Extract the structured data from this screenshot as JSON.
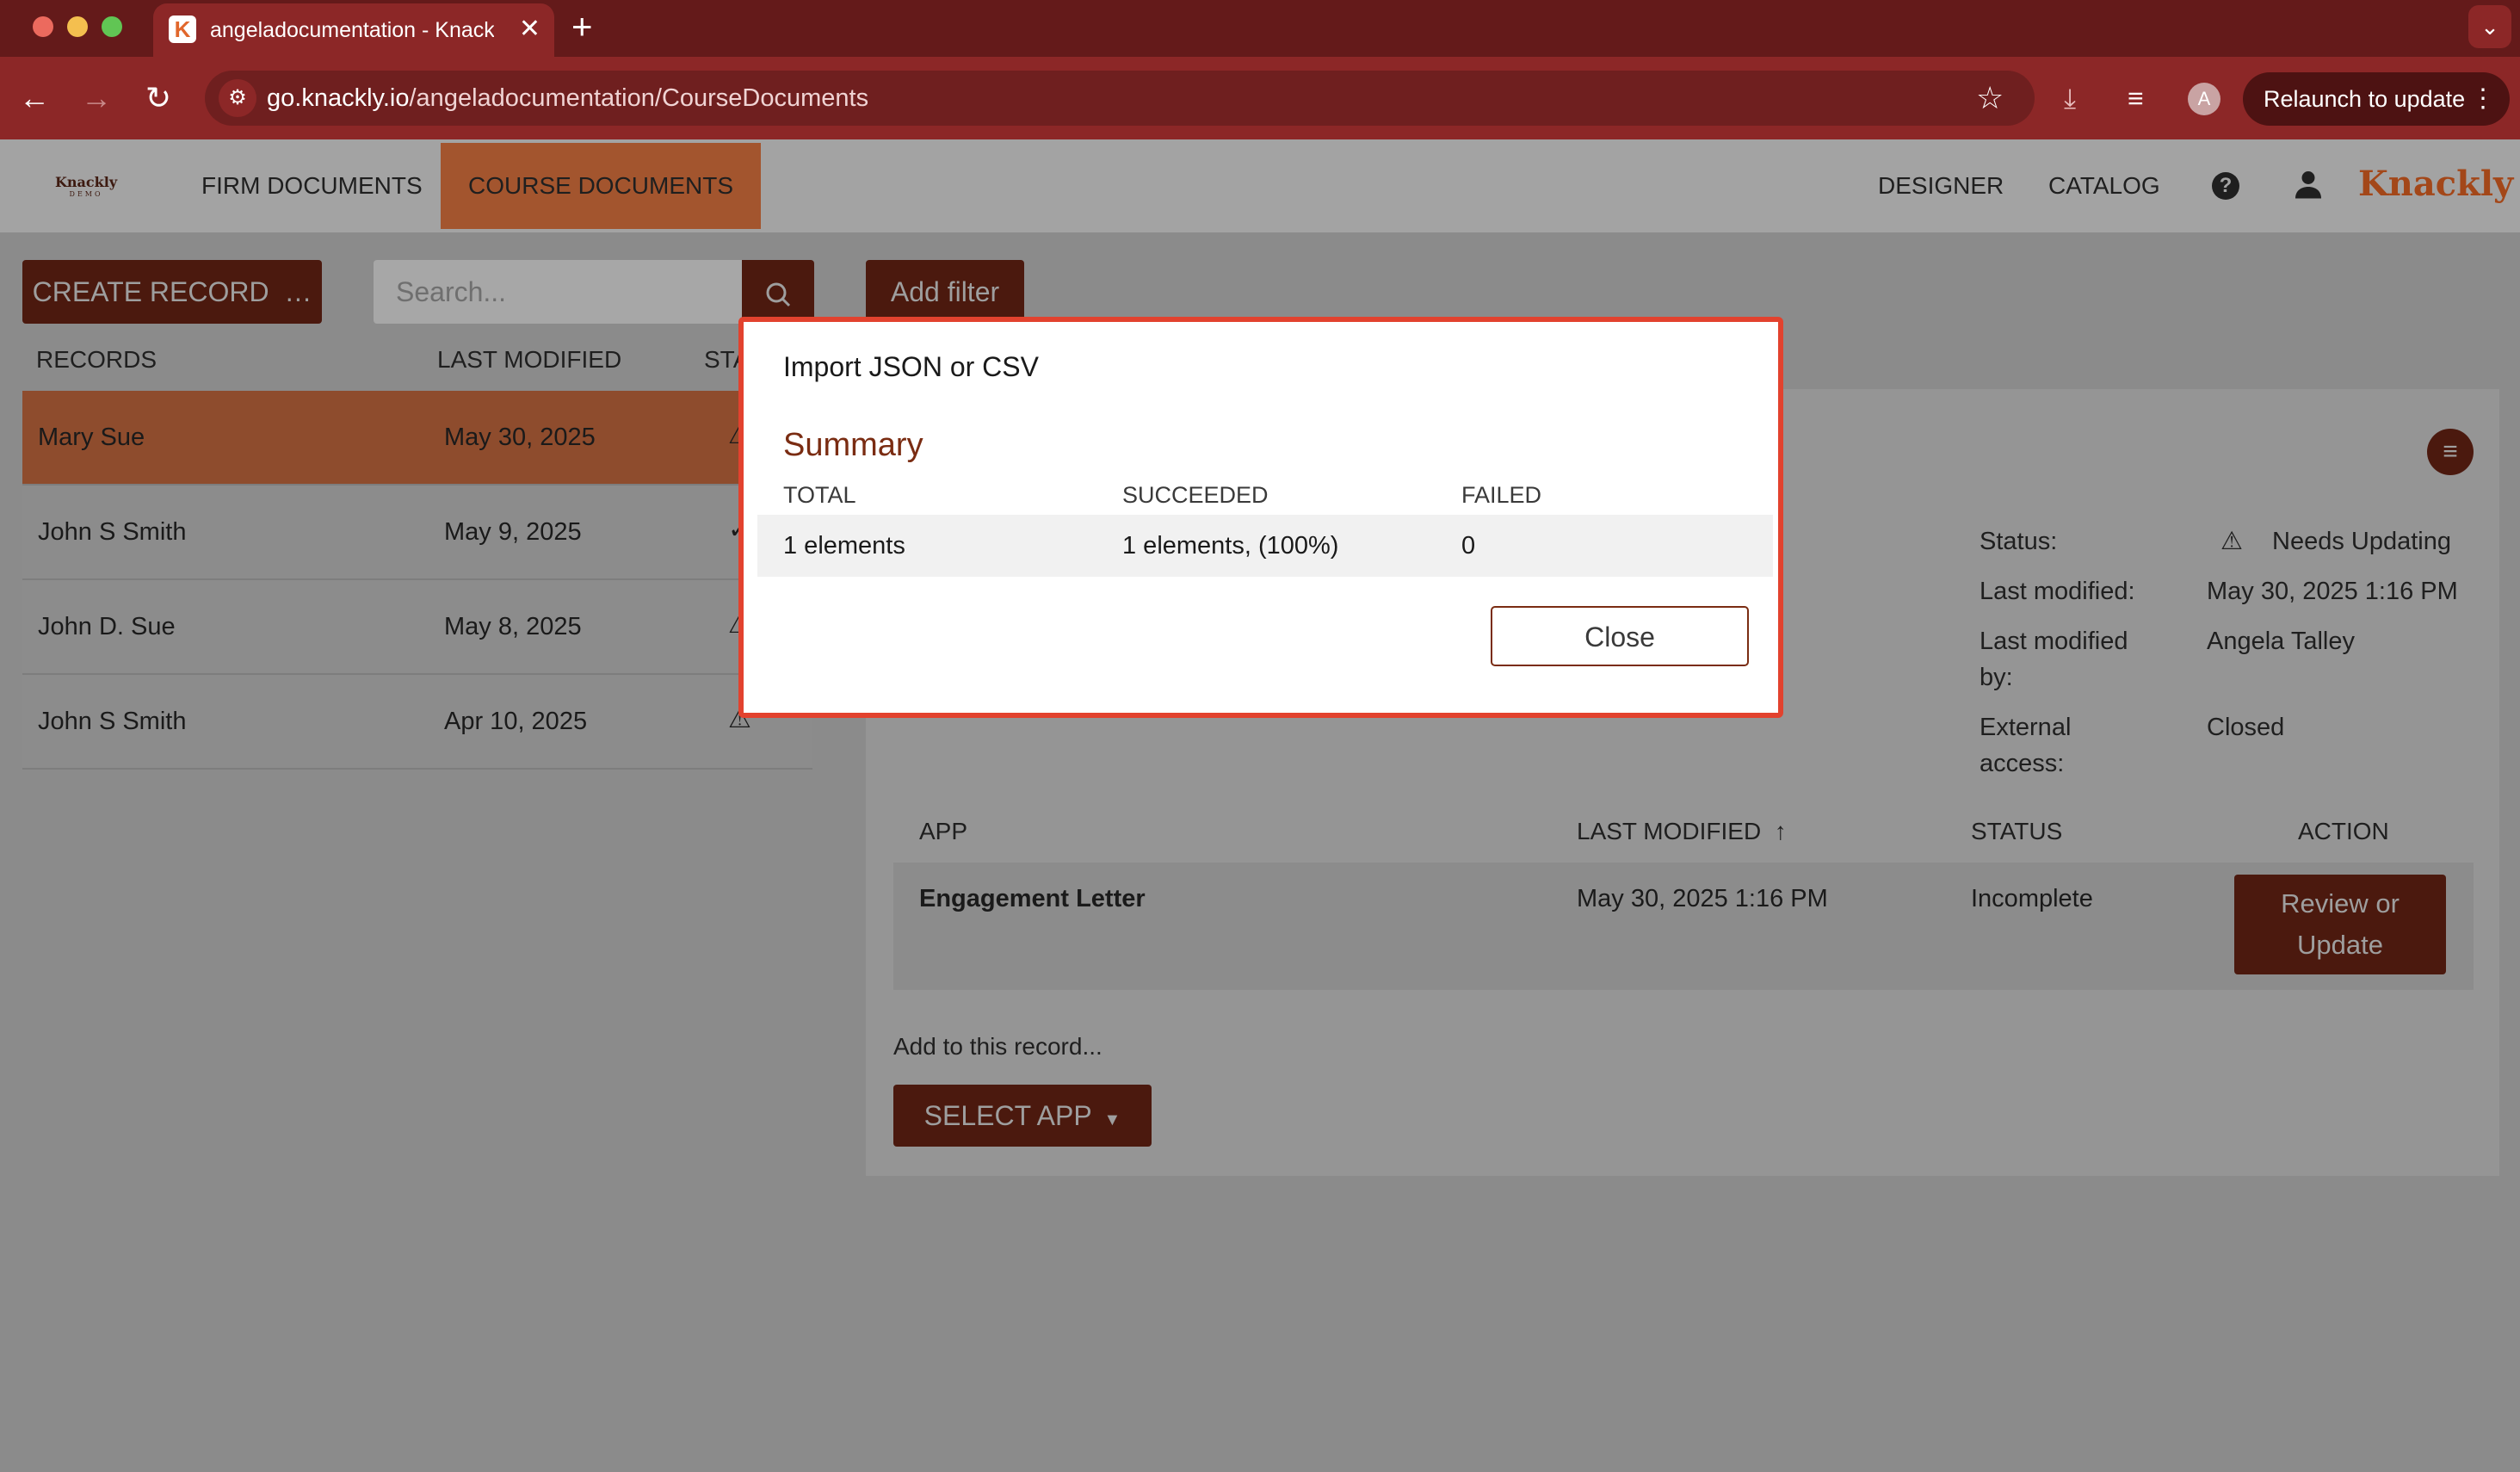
{
  "browser": {
    "tab_title": "angeladocumentation - Knackly",
    "url_host": "go.knackly.io",
    "url_path": "/angeladocumentation/CourseDocuments",
    "profile_initial": "A",
    "relaunch_label": "Relaunch to update",
    "colors": {
      "tabbar": "#641a1a",
      "toolbar": "#8c2727"
    }
  },
  "app": {
    "logo_small": "Knackly",
    "logo_small_sub": "DEMO",
    "nav": {
      "firm_documents": "FIRM DOCUMENTS",
      "course_documents": "COURSE DOCUMENTS",
      "designer": "DESIGNER",
      "catalog": "CATALOG"
    },
    "brand": "Knackly",
    "accent_color": "#a3552e",
    "create_record": "CREATE RECORD",
    "search_placeholder": "Search...",
    "add_filter": "Add filter",
    "records_headers": {
      "records": "RECORDS",
      "last_modified": "LAST MODIFIED",
      "status": "STATUS"
    },
    "records": [
      {
        "name": "Mary Sue",
        "date": "May 30, 2025",
        "status_icon": "warning-icon"
      },
      {
        "name": "John S Smith",
        "date": "May 9, 2025",
        "status_icon": "check-icon"
      },
      {
        "name": "John D. Sue",
        "date": "May 8, 2025",
        "status_icon": "warning-icon"
      },
      {
        "name": "John S Smith",
        "date": "Apr 10, 2025",
        "status_icon": "warning-icon"
      }
    ],
    "detail": {
      "status_label": "Status:",
      "status_value": "Needs Updating",
      "last_modified_label": "Last modified:",
      "last_modified_value": "May 30, 2025 1:16 PM",
      "last_modified_by_label_1": "Last modified",
      "last_modified_by_label_2": "by:",
      "last_modified_by_value": "Angela Talley",
      "external_access_label_1": "External",
      "external_access_label_2": "access:",
      "external_access_value": "Closed",
      "table_headers": {
        "app": "APP",
        "last_modified": "LAST MODIFIED",
        "status": "STATUS",
        "action": "ACTION"
      },
      "apps": [
        {
          "name": "Engagement Letter",
          "last_modified": "May 30, 2025 1:16 PM",
          "status": "Incomplete",
          "action_line1": "Review or",
          "action_line2": "Update"
        }
      ],
      "add_to_record": "Add to this record...",
      "select_app": "SELECT APP"
    }
  },
  "modal": {
    "title": "Import JSON or CSV",
    "summary_heading": "Summary",
    "columns": {
      "total": "TOTAL",
      "succeeded": "SUCCEEDED",
      "failed": "FAILED"
    },
    "row": {
      "total": "1 elements",
      "succeeded": "1 elements, (100%)",
      "failed": "0"
    },
    "close_label": "Close"
  }
}
